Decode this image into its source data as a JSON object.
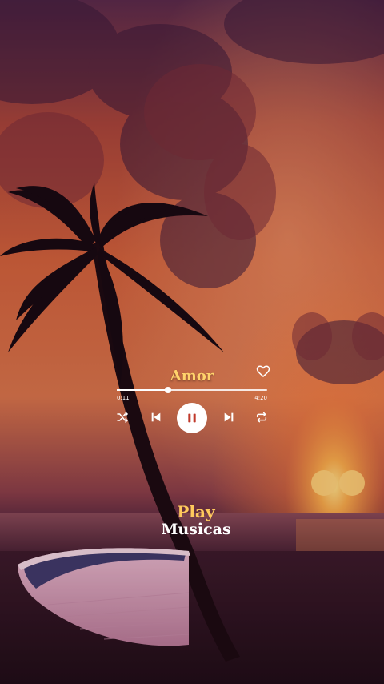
{
  "player": {
    "title": "Amor",
    "current_time": "0:11",
    "total_time": "4:20",
    "progress": 0.34,
    "state": "playing"
  },
  "brand": {
    "line1": "Play",
    "line2": "Musicas"
  },
  "icons": {
    "favorite": "heart-outline-icon",
    "shuffle": "shuffle-icon",
    "previous": "skip-previous-icon",
    "pause": "pause-icon",
    "next": "skip-next-icon",
    "repeat": "repeat-icon"
  },
  "colors": {
    "title": "#ffd36b",
    "brand_accent": "#ffc95c",
    "controls": "#ffffff",
    "play_button_icon": "#c0392b"
  }
}
